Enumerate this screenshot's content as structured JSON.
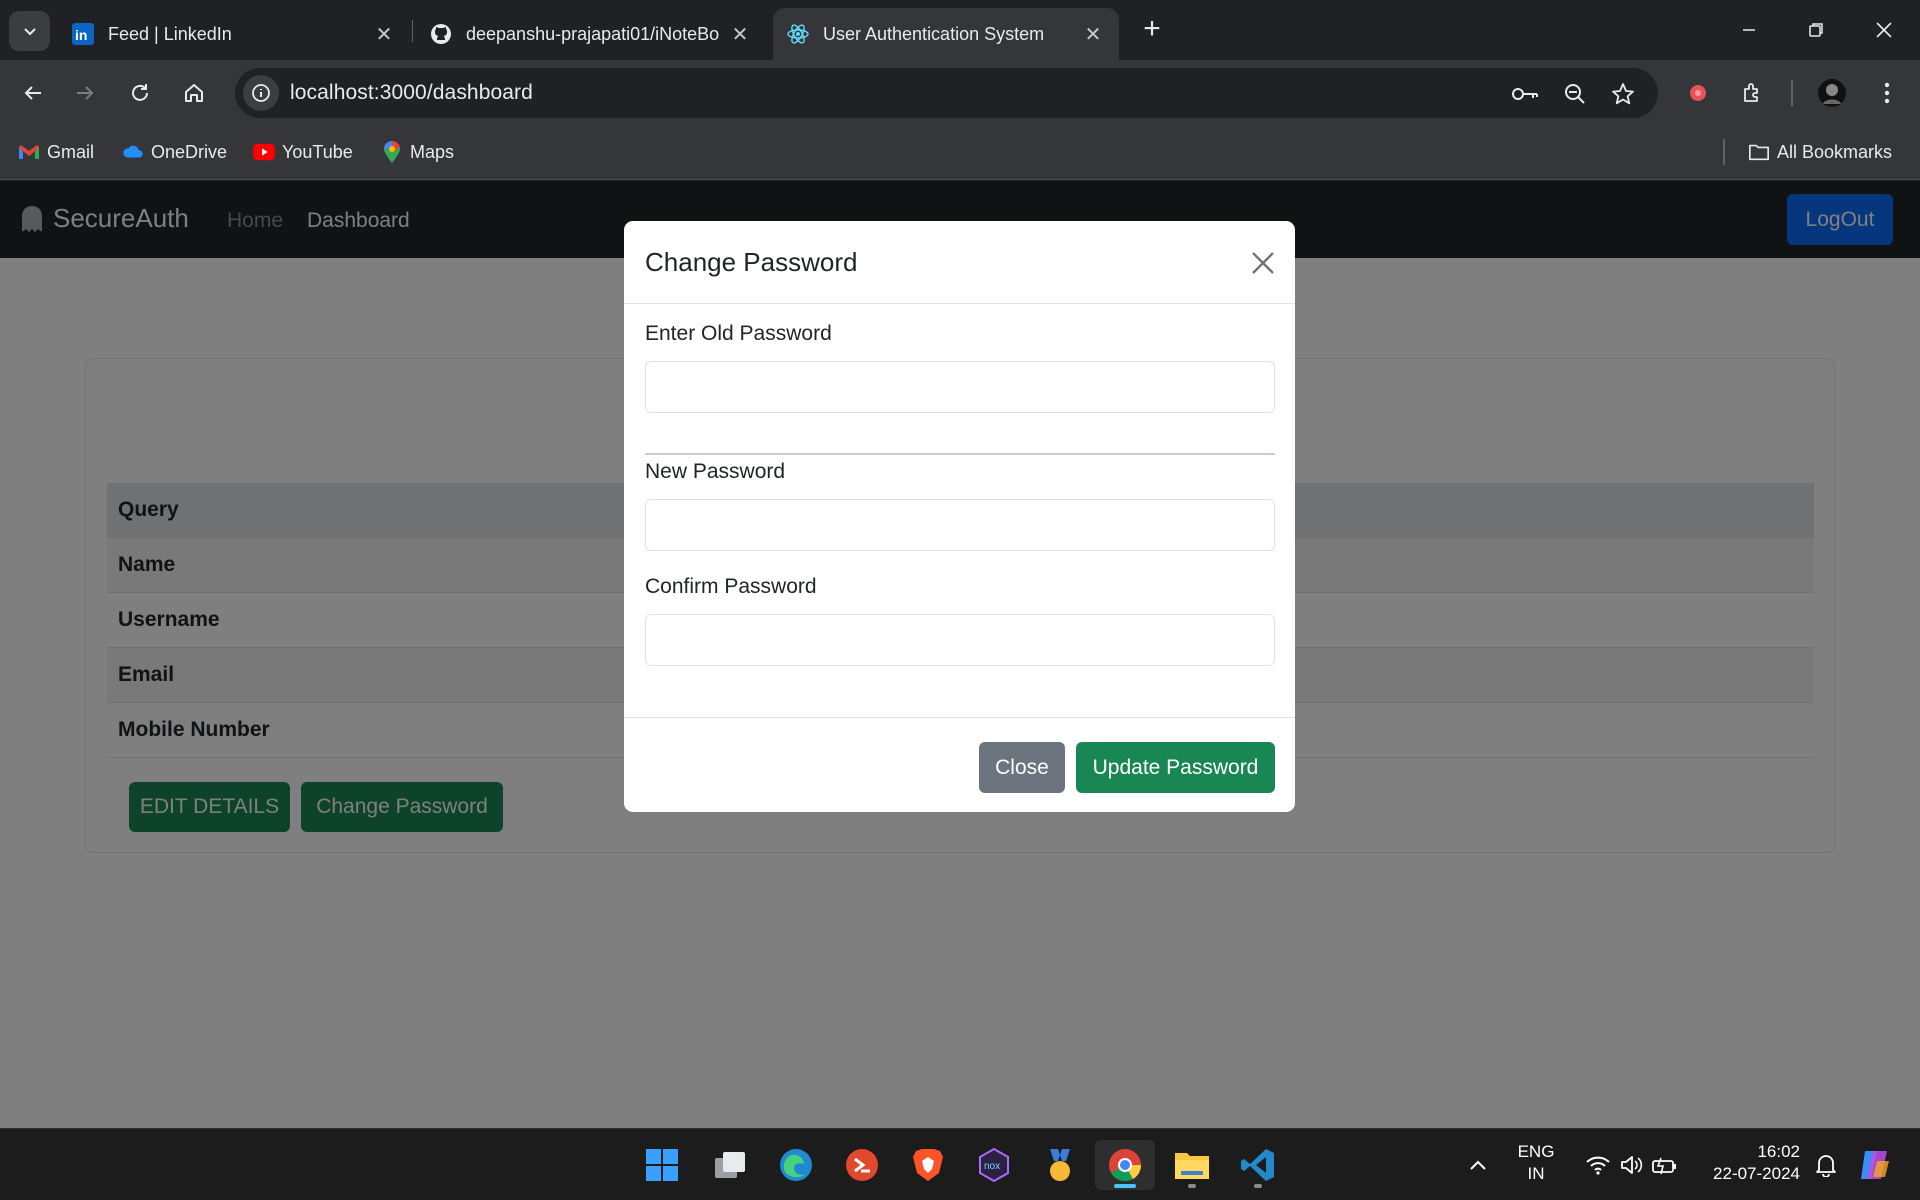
{
  "browser": {
    "tabs": [
      {
        "title": "Feed | LinkedIn",
        "icon": "linkedin-icon"
      },
      {
        "title": "deepanshu-prajapati01/iNoteBo",
        "icon": "github-icon"
      },
      {
        "title": "User Authentication System",
        "icon": "react-icon",
        "active": true
      }
    ],
    "url": "localhost:3000/dashboard",
    "bookmarks": [
      {
        "label": "Gmail",
        "icon": "gmail-icon"
      },
      {
        "label": "OneDrive",
        "icon": "onedrive-icon"
      },
      {
        "label": "YouTube",
        "icon": "youtube-icon"
      },
      {
        "label": "Maps",
        "icon": "maps-icon"
      }
    ],
    "all_bookmarks": "All Bookmarks"
  },
  "app": {
    "brand": "SecureAuth",
    "nav": {
      "home": "Home",
      "dashboard": "Dashboard"
    },
    "logout": "LogOut",
    "table": {
      "header": "Query",
      "rows": [
        "Name",
        "Username",
        "Email",
        "Mobile Number"
      ]
    },
    "buttons": {
      "edit": "EDIT DETAILS",
      "change_password": "Change Password"
    }
  },
  "modal": {
    "title": "Change Password",
    "fields": {
      "old_password": {
        "label": "Enter Old Password",
        "value": ""
      },
      "new_password": {
        "label": "New Password",
        "value": ""
      },
      "confirm_password": {
        "label": "Confirm Password",
        "value": ""
      }
    },
    "close": "Close",
    "submit": "Update Password"
  },
  "taskbar": {
    "language": {
      "line1": "ENG",
      "line2": "IN"
    },
    "time": "16:02",
    "date": "22-07-2024"
  },
  "colors": {
    "primary": "#0d6efd",
    "success": "#198754",
    "secondary": "#6c757d",
    "navbar": "#212529"
  }
}
